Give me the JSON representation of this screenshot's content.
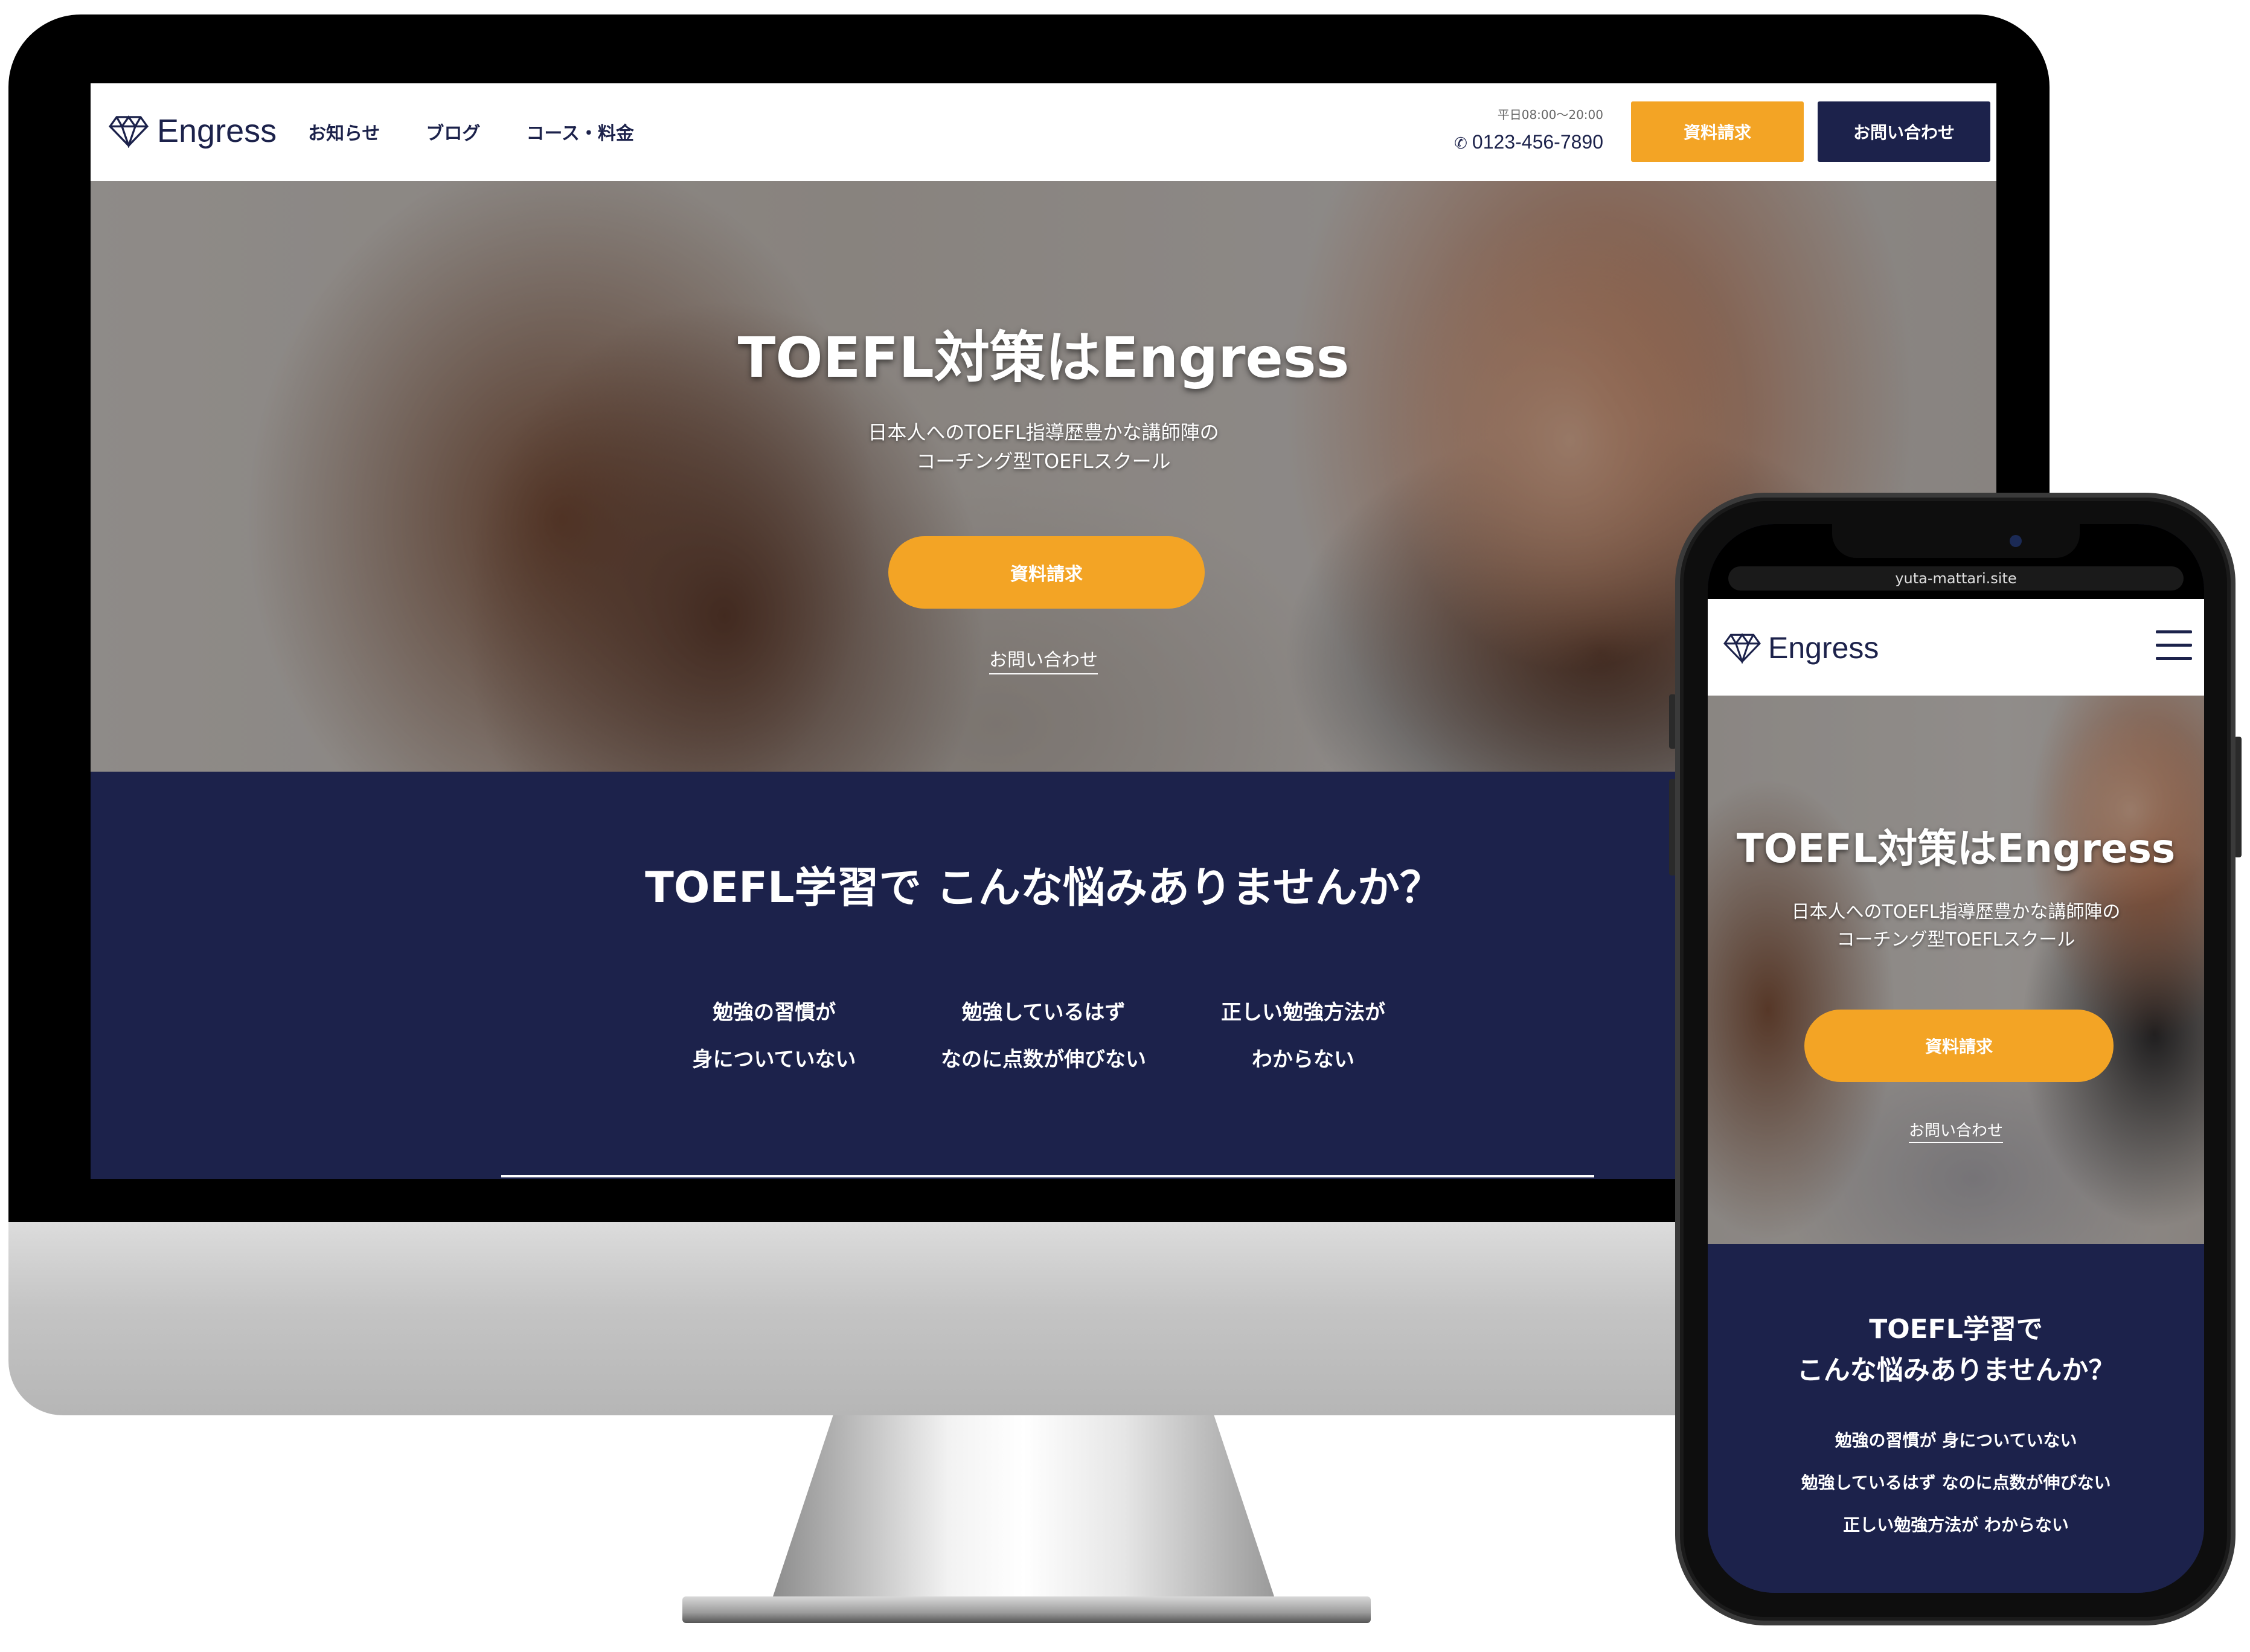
{
  "desktop": {
    "header": {
      "logo_text": "Engress",
      "nav": [
        "お知らせ",
        "ブログ",
        "コース・料金"
      ],
      "hours": "平日08:00〜20:00",
      "phone": "0123-456-7890",
      "request_button": "資料請求",
      "contact_button": "お問い合わせ"
    },
    "hero": {
      "title": "TOEFL対策はEngress",
      "subtitle_line1": "日本人へのTOEFL指導歴豊かな講師陣の",
      "subtitle_line2": "コーチング型TOEFLスクール",
      "cta_button": "資料請求",
      "contact_link": "お問い合わせ"
    },
    "problems": {
      "title": "TOEFL学習で こんな悩みありませんか？",
      "items": [
        {
          "line1": "勉強の習慣が",
          "line2": "身についていない"
        },
        {
          "line1": "勉強しているはず",
          "line2": "なのに点数が伸びない"
        },
        {
          "line1": "正しい勉強方法が",
          "line2": "わからない"
        }
      ]
    }
  },
  "phone": {
    "url": "yuta-mattari.site",
    "header": {
      "logo_text": "Engress"
    },
    "hero": {
      "title": "TOEFL対策はEngress",
      "subtitle_line1": "日本人へのTOEFL指導歴豊かな講師陣の",
      "subtitle_line2": "コーチング型TOEFLスクール",
      "cta_button": "資料請求",
      "contact_link": "お問い合わせ"
    },
    "problems": {
      "title_line1": "TOEFL学習で",
      "title_line2": "こんな悩みありませんか？",
      "items": [
        "勉強の習慣が 身についていない",
        "勉強しているはず なのに点数が伸びない",
        "正しい勉強方法が わからない"
      ]
    }
  },
  "colors": {
    "navy": "#1c224b",
    "accent_orange": "#f3a425",
    "white": "#ffffff"
  },
  "icons": {
    "logo": "diamond-icon",
    "phone": "phone-icon",
    "menu": "hamburger-menu-icon"
  }
}
